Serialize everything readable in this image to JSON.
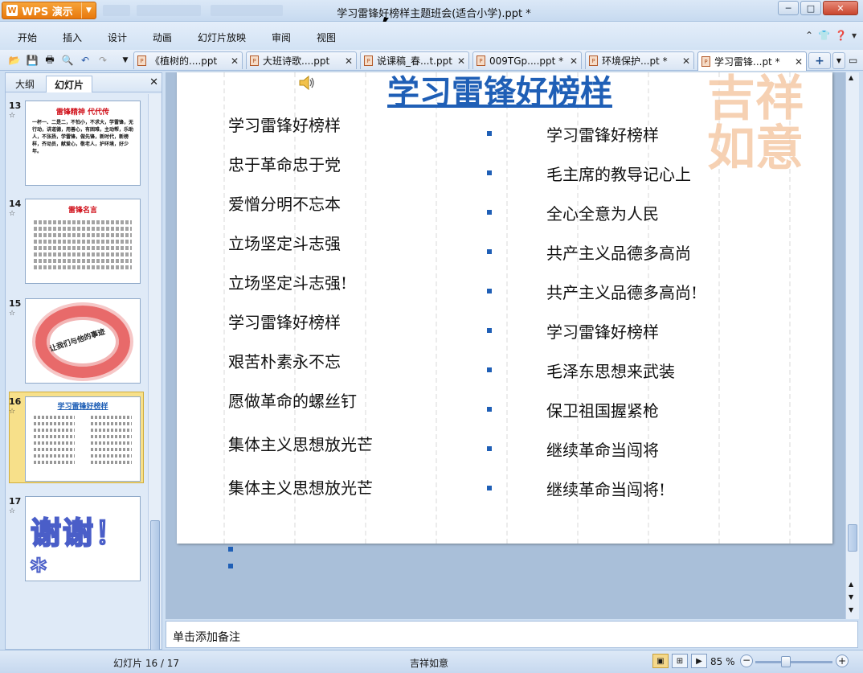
{
  "app": {
    "button_label": "WPS 演示",
    "logo_letter": "W",
    "window_title": "学习雷锋好榜样主题班会(适合小学).ppt *"
  },
  "window_controls": {
    "minimize": "─",
    "maximize": "□",
    "close": "✕"
  },
  "menu": [
    "开始",
    "插入",
    "设计",
    "动画",
    "幻灯片放映",
    "审阅",
    "视图"
  ],
  "doc_tabs": [
    {
      "label": "《植树的....ppt"
    },
    {
      "label": "大班诗歌....ppt"
    },
    {
      "label": "说课稿_春...t.ppt"
    },
    {
      "label": "009TGp....ppt *"
    },
    {
      "label": "环境保护...pt *"
    },
    {
      "label": "学习雷锋...pt *",
      "active": true
    }
  ],
  "tab_close": "✕",
  "left_panel": {
    "tabs": [
      "大纲",
      "幻灯片"
    ],
    "active_tab": "幻灯片",
    "close": "✕",
    "thumbnails": [
      {
        "number": "13",
        "title": "雷锋精神 代代传",
        "body": "一杯一、二是二，不怕小，不求大，学雷锋，无行动，讲道德，用善心，有困难，主动帮，乐助人，不张扬，学雷锋，做先锋，新时代，新榜样，齐动员，献爱心，敬老人，护环境，好少年。"
      },
      {
        "number": "14",
        "title": "雷锋名言"
      },
      {
        "number": "15",
        "title": "让我们与他的事迹"
      },
      {
        "number": "16",
        "title": "学习雷锋好榜样",
        "selected": true
      },
      {
        "number": "17",
        "title": "谢谢！*"
      }
    ]
  },
  "slide": {
    "title": "学习雷锋好榜样",
    "left_lines": [
      "学习雷锋好榜样",
      "忠于革命忠于党",
      "爱憎分明不忘本",
      "立场坚定斗志强",
      "立场坚定斗志强!",
      "学习雷锋好榜样",
      "艰苦朴素永不忘",
      "愿做革命的螺丝钉",
      "集体主义思想放光芒",
      "集体主义思想放光芒"
    ],
    "right_lines": [
      "学习雷锋好榜样",
      "毛主席的教导记心上",
      "全心全意为人民",
      "共产主义品德多高尚",
      "共产主义品德多高尚!",
      "学习雷锋好榜样",
      "毛泽东思想来武装",
      "保卫祖国握紧枪",
      "继续革命当闯将",
      "继续革命当闯将!"
    ]
  },
  "notes": {
    "placeholder": "单击添加备注"
  },
  "status": {
    "slide_counter": "幻灯片 16 / 17",
    "theme": "吉祥如意",
    "zoom": "85 %",
    "zoom_level_percent": 85
  }
}
